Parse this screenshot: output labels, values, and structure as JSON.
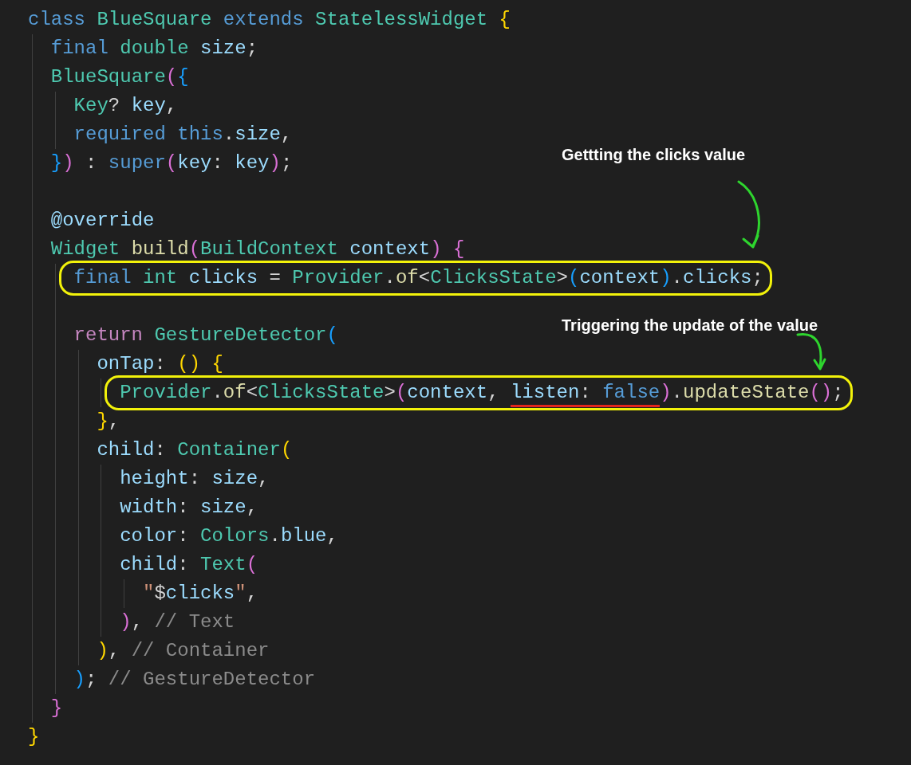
{
  "code_lines": [
    {
      "tokens": [
        {
          "t": "class ",
          "kind": "keyword"
        },
        {
          "t": "BlueSquare ",
          "kind": "type"
        },
        {
          "t": "extends ",
          "kind": "keyword"
        },
        {
          "t": "StatelessWidget ",
          "kind": "type"
        },
        {
          "t": "{",
          "kind": "bracket1"
        }
      ]
    },
    {
      "tokens": [
        {
          "t": "  final ",
          "kind": "keyword"
        },
        {
          "t": "double ",
          "kind": "type"
        },
        {
          "t": "size",
          "kind": "variable"
        },
        {
          "t": ";",
          "kind": "punct"
        }
      ]
    },
    {
      "tokens": [
        {
          "t": "  BlueSquare",
          "kind": "type"
        },
        {
          "t": "(",
          "kind": "bracket2"
        },
        {
          "t": "{",
          "kind": "bracket3"
        }
      ]
    },
    {
      "tokens": [
        {
          "t": "    Key",
          "kind": "type"
        },
        {
          "t": "? ",
          "kind": "punct"
        },
        {
          "t": "key",
          "kind": "variable"
        },
        {
          "t": ",",
          "kind": "punct"
        }
      ]
    },
    {
      "tokens": [
        {
          "t": "    required ",
          "kind": "keyword"
        },
        {
          "t": "this",
          "kind": "keyword"
        },
        {
          "t": ".",
          "kind": "punct"
        },
        {
          "t": "size",
          "kind": "variable"
        },
        {
          "t": ",",
          "kind": "punct"
        }
      ]
    },
    {
      "tokens": [
        {
          "t": "  }",
          "kind": "bracket3"
        },
        {
          "t": ")",
          "kind": "bracket2"
        },
        {
          "t": " : ",
          "kind": "punct"
        },
        {
          "t": "super",
          "kind": "keyword"
        },
        {
          "t": "(",
          "kind": "bracket2"
        },
        {
          "t": "key",
          "kind": "variable"
        },
        {
          "t": ": ",
          "kind": "punct"
        },
        {
          "t": "key",
          "kind": "variable"
        },
        {
          "t": ")",
          "kind": "bracket2"
        },
        {
          "t": ";",
          "kind": "punct"
        }
      ]
    },
    {
      "blank_before": true,
      "tokens": [
        {
          "t": "  @override",
          "kind": "variable"
        }
      ]
    },
    {
      "tokens": [
        {
          "t": "  Widget ",
          "kind": "type"
        },
        {
          "t": "build",
          "kind": "function"
        },
        {
          "t": "(",
          "kind": "bracket2"
        },
        {
          "t": "BuildContext ",
          "kind": "type"
        },
        {
          "t": "context",
          "kind": "variable"
        },
        {
          "t": ") ",
          "kind": "bracket2"
        },
        {
          "t": "{",
          "kind": "bracket2"
        }
      ]
    },
    {
      "highlight": true,
      "tokens": [
        {
          "t": "    final ",
          "kind": "keyword"
        },
        {
          "t": "int ",
          "kind": "type"
        },
        {
          "t": "clicks",
          "kind": "variable"
        },
        {
          "t": " = ",
          "kind": "punct"
        },
        {
          "t": "Provider",
          "kind": "type"
        },
        {
          "t": ".",
          "kind": "punct"
        },
        {
          "t": "of",
          "kind": "function"
        },
        {
          "t": "<",
          "kind": "punct"
        },
        {
          "t": "ClicksState",
          "kind": "type"
        },
        {
          "t": ">",
          "kind": "punct"
        },
        {
          "t": "(",
          "kind": "bracket3"
        },
        {
          "t": "context",
          "kind": "variable"
        },
        {
          "t": ")",
          "kind": "bracket3"
        },
        {
          "t": ".",
          "kind": "punct"
        },
        {
          "t": "clicks",
          "kind": "variable"
        },
        {
          "t": ";",
          "kind": "punct"
        }
      ]
    },
    {
      "blank_before": true,
      "tokens": [
        {
          "t": "    return ",
          "kind": "control"
        },
        {
          "t": "GestureDetector",
          "kind": "type"
        },
        {
          "t": "(",
          "kind": "bracket3"
        }
      ]
    },
    {
      "tokens": [
        {
          "t": "      onTap",
          "kind": "variable"
        },
        {
          "t": ": ",
          "kind": "punct"
        },
        {
          "t": "()",
          "kind": "bracket1"
        },
        {
          "t": " {",
          "kind": "bracket1"
        }
      ]
    },
    {
      "highlight": true,
      "tokens": [
        {
          "t": "        Provider",
          "kind": "type"
        },
        {
          "t": ".",
          "kind": "punct"
        },
        {
          "t": "of",
          "kind": "function"
        },
        {
          "t": "<",
          "kind": "punct"
        },
        {
          "t": "ClicksState",
          "kind": "type"
        },
        {
          "t": ">",
          "kind": "punct"
        },
        {
          "t": "(",
          "kind": "bracket2"
        },
        {
          "t": "context",
          "kind": "variable"
        },
        {
          "t": ", ",
          "kind": "punct"
        },
        {
          "t": "listen",
          "kind": "variable",
          "underline": true
        },
        {
          "t": ": ",
          "kind": "punct",
          "underline": true
        },
        {
          "t": "false",
          "kind": "keyword",
          "underline": true
        },
        {
          "t": ")",
          "kind": "bracket2"
        },
        {
          "t": ".",
          "kind": "punct"
        },
        {
          "t": "updateState",
          "kind": "function"
        },
        {
          "t": "()",
          "kind": "bracket2"
        },
        {
          "t": ";",
          "kind": "punct"
        }
      ]
    },
    {
      "tokens": [
        {
          "t": "      }",
          "kind": "bracket1"
        },
        {
          "t": ",",
          "kind": "punct"
        }
      ]
    },
    {
      "tokens": [
        {
          "t": "      child",
          "kind": "variable"
        },
        {
          "t": ": ",
          "kind": "punct"
        },
        {
          "t": "Container",
          "kind": "type"
        },
        {
          "t": "(",
          "kind": "bracket1"
        }
      ]
    },
    {
      "tokens": [
        {
          "t": "        height",
          "kind": "variable"
        },
        {
          "t": ": ",
          "kind": "punct"
        },
        {
          "t": "size",
          "kind": "variable"
        },
        {
          "t": ",",
          "kind": "punct"
        }
      ]
    },
    {
      "tokens": [
        {
          "t": "        width",
          "kind": "variable"
        },
        {
          "t": ": ",
          "kind": "punct"
        },
        {
          "t": "size",
          "kind": "variable"
        },
        {
          "t": ",",
          "kind": "punct"
        }
      ]
    },
    {
      "tokens": [
        {
          "t": "        color",
          "kind": "variable"
        },
        {
          "t": ": ",
          "kind": "punct"
        },
        {
          "t": "Colors",
          "kind": "type"
        },
        {
          "t": ".",
          "kind": "punct"
        },
        {
          "t": "blue",
          "kind": "variable"
        },
        {
          "t": ",",
          "kind": "punct"
        }
      ]
    },
    {
      "tokens": [
        {
          "t": "        child",
          "kind": "variable"
        },
        {
          "t": ": ",
          "kind": "punct"
        },
        {
          "t": "Text",
          "kind": "type"
        },
        {
          "t": "(",
          "kind": "bracket2"
        }
      ]
    },
    {
      "tokens": [
        {
          "t": "          \"",
          "kind": "string"
        },
        {
          "t": "$",
          "kind": "punct"
        },
        {
          "t": "clicks",
          "kind": "variable"
        },
        {
          "t": "\"",
          "kind": "string"
        },
        {
          "t": ",",
          "kind": "punct"
        }
      ]
    },
    {
      "tokens": [
        {
          "t": "        )",
          "kind": "bracket2"
        },
        {
          "t": ", ",
          "kind": "punct"
        },
        {
          "t": "// Text",
          "kind": "comment"
        }
      ]
    },
    {
      "tokens": [
        {
          "t": "      )",
          "kind": "bracket1"
        },
        {
          "t": ", ",
          "kind": "punct"
        },
        {
          "t": "// Container",
          "kind": "comment"
        }
      ]
    },
    {
      "tokens": [
        {
          "t": "    )",
          "kind": "bracket3"
        },
        {
          "t": "; ",
          "kind": "punct"
        },
        {
          "t": "// GestureDetector",
          "kind": "comment"
        }
      ]
    },
    {
      "tokens": [
        {
          "t": "  }",
          "kind": "bracket2"
        }
      ]
    },
    {
      "tokens": [
        {
          "t": "}",
          "kind": "bracket1"
        }
      ]
    }
  ],
  "annotations": [
    {
      "text": "Gettting the clicks value"
    },
    {
      "text": "Triggering the update of the value"
    }
  ]
}
